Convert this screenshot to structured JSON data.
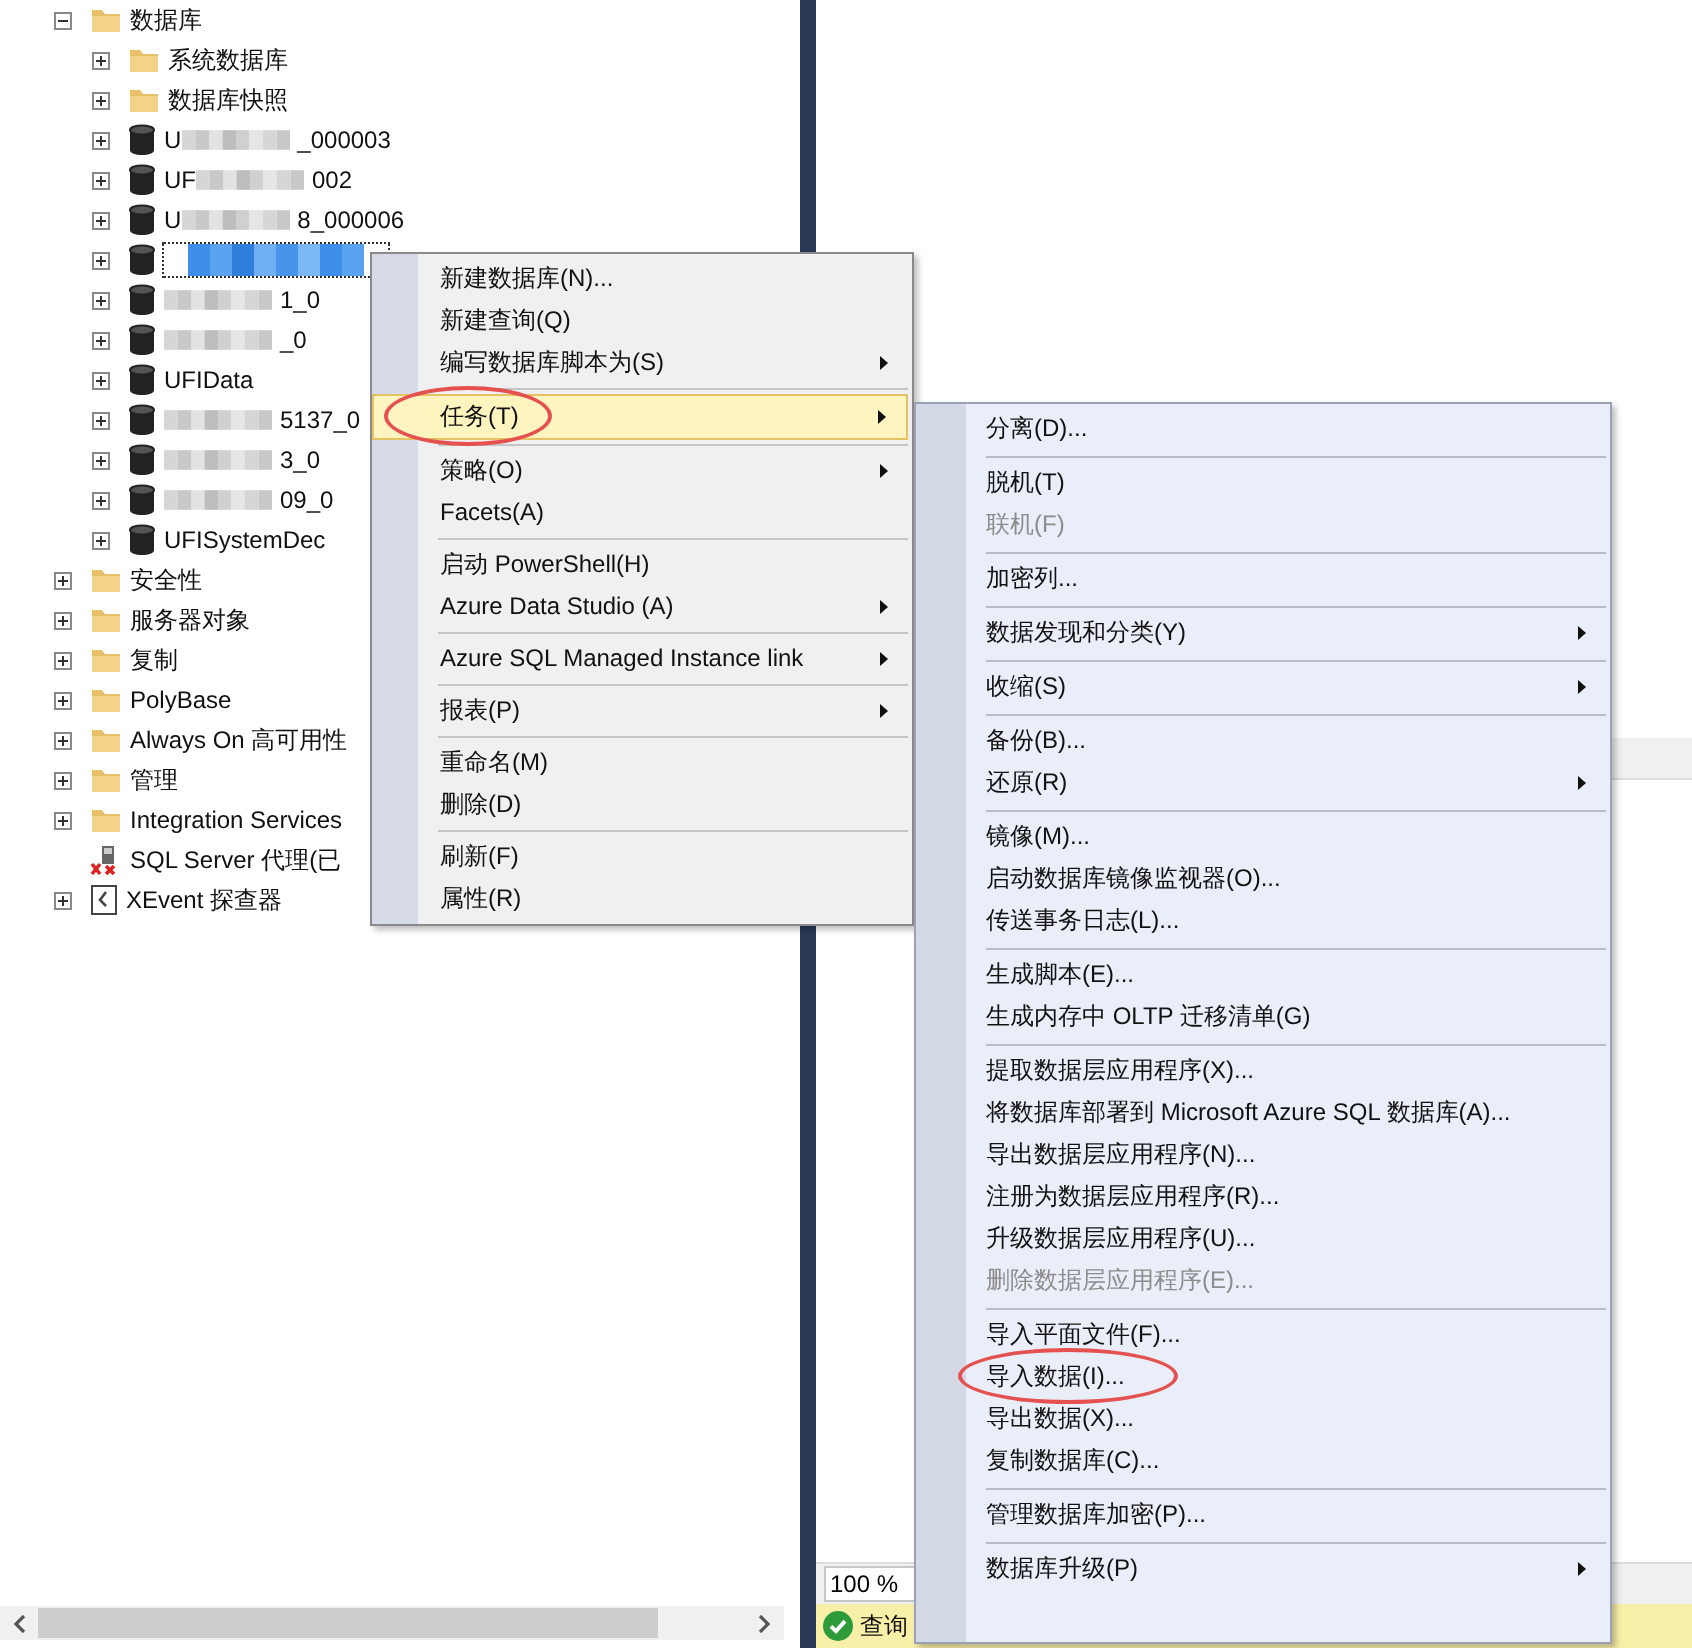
{
  "tree": [
    {
      "label": "数据库",
      "kind": "folder",
      "expanded": true,
      "children": [
        {
          "label": "系统数据库",
          "kind": "folder",
          "expanded": false
        },
        {
          "label": "数据库快照",
          "kind": "folder",
          "expanded": false
        },
        {
          "kind": "database",
          "expanded": false,
          "redacted": true,
          "selected": false,
          "prefix": "U",
          "suffix": "_000003"
        },
        {
          "kind": "database",
          "expanded": false,
          "redacted": true,
          "selected": false,
          "prefix": "UF",
          "suffix": "002"
        },
        {
          "kind": "database",
          "expanded": false,
          "redacted": true,
          "selected": false,
          "prefix": "U",
          "suffix": "8_000006"
        },
        {
          "kind": "database",
          "expanded": false,
          "redacted": true,
          "selected": true
        },
        {
          "kind": "database",
          "expanded": false,
          "redacted": true,
          "selected": false,
          "suffix": "1_0"
        },
        {
          "kind": "database",
          "expanded": false,
          "redacted": true,
          "selected": false,
          "suffix": "_0"
        },
        {
          "kind": "database",
          "expanded": false,
          "redacted": false,
          "selected": false,
          "prefix": "UFIData"
        },
        {
          "kind": "database",
          "expanded": false,
          "redacted": true,
          "selected": false,
          "suffix": "5137_0"
        },
        {
          "kind": "database",
          "expanded": false,
          "redacted": true,
          "selected": false,
          "suffix": "3_0"
        },
        {
          "kind": "database",
          "expanded": false,
          "redacted": true,
          "selected": false,
          "suffix": "09_0"
        },
        {
          "kind": "database",
          "expanded": false,
          "redacted": false,
          "selected": false,
          "prefix": "UFISystemDec"
        }
      ]
    },
    {
      "label": "安全性",
      "kind": "folder",
      "expanded": false
    },
    {
      "label": "服务器对象",
      "kind": "folder",
      "expanded": false
    },
    {
      "label": "复制",
      "kind": "folder",
      "expanded": false
    },
    {
      "label": "PolyBase",
      "kind": "folder",
      "expanded": false
    },
    {
      "label": "Always On 高可用性",
      "kind": "folder",
      "expanded": false
    },
    {
      "label": "管理",
      "kind": "folder",
      "expanded": false
    },
    {
      "label": "Integration Services",
      "kind": "folder",
      "expanded": false
    },
    {
      "label": "SQL Server 代理(已",
      "kind": "agent"
    },
    {
      "label": "XEvent 探查器",
      "kind": "xevent",
      "expanded": false
    }
  ],
  "context_menu": {
    "groups": [
      [
        {
          "label": "新建数据库(N)...",
          "submenu": false,
          "selected": false,
          "circled": false
        },
        {
          "label": "新建查询(Q)",
          "submenu": false,
          "selected": false,
          "circled": false
        },
        {
          "label": "编写数据库脚本为(S)",
          "submenu": true,
          "selected": false,
          "circled": false
        }
      ],
      [
        {
          "label": "任务(T)",
          "submenu": true,
          "selected": true,
          "circled": true
        }
      ],
      [
        {
          "label": "策略(O)",
          "submenu": true,
          "selected": false,
          "circled": false
        },
        {
          "label": "Facets(A)",
          "submenu": false,
          "selected": false,
          "circled": false
        }
      ],
      [
        {
          "label": "启动 PowerShell(H)",
          "submenu": false,
          "selected": false,
          "circled": false
        },
        {
          "label": "Azure Data Studio (A)",
          "submenu": true,
          "selected": false,
          "circled": false
        }
      ],
      [
        {
          "label": "Azure SQL Managed Instance link",
          "submenu": true,
          "selected": false,
          "circled": false
        }
      ],
      [
        {
          "label": "报表(P)",
          "submenu": true,
          "selected": false,
          "circled": false
        }
      ],
      [
        {
          "label": "重命名(M)",
          "submenu": false,
          "selected": false,
          "circled": false
        },
        {
          "label": "删除(D)",
          "submenu": false,
          "selected": false,
          "circled": false
        }
      ],
      [
        {
          "label": "刷新(F)",
          "submenu": false,
          "selected": false,
          "circled": false
        },
        {
          "label": "属性(R)",
          "submenu": false,
          "selected": false,
          "circled": false
        }
      ]
    ]
  },
  "tasks_menu": {
    "groups": [
      [
        {
          "label": "分离(D)...",
          "submenu": false,
          "disabled": false,
          "circled": false
        }
      ],
      [
        {
          "label": "脱机(T)",
          "submenu": false,
          "disabled": false,
          "circled": false
        },
        {
          "label": "联机(F)",
          "submenu": false,
          "disabled": true,
          "circled": false
        }
      ],
      [
        {
          "label": "加密列...",
          "submenu": false,
          "disabled": false,
          "circled": false
        }
      ],
      [
        {
          "label": "数据发现和分类(Y)",
          "submenu": true,
          "disabled": false,
          "circled": false
        }
      ],
      [
        {
          "label": "收缩(S)",
          "submenu": true,
          "disabled": false,
          "circled": false
        }
      ],
      [
        {
          "label": "备份(B)...",
          "submenu": false,
          "disabled": false,
          "circled": false
        },
        {
          "label": "还原(R)",
          "submenu": true,
          "disabled": false,
          "circled": false
        }
      ],
      [
        {
          "label": "镜像(M)...",
          "submenu": false,
          "disabled": false,
          "circled": false
        },
        {
          "label": "启动数据库镜像监视器(O)...",
          "submenu": false,
          "disabled": false,
          "circled": false
        },
        {
          "label": "传送事务日志(L)...",
          "submenu": false,
          "disabled": false,
          "circled": false
        }
      ],
      [
        {
          "label": "生成脚本(E)...",
          "submenu": false,
          "disabled": false,
          "circled": false
        },
        {
          "label": "生成内存中 OLTP 迁移清单(G)",
          "submenu": false,
          "disabled": false,
          "circled": false
        }
      ],
      [
        {
          "label": "提取数据层应用程序(X)...",
          "submenu": false,
          "disabled": false,
          "circled": false
        },
        {
          "label": "将数据库部署到 Microsoft Azure SQL 数据库(A)...",
          "submenu": false,
          "disabled": false,
          "circled": false
        },
        {
          "label": "导出数据层应用程序(N)...",
          "submenu": false,
          "disabled": false,
          "circled": false
        },
        {
          "label": "注册为数据层应用程序(R)...",
          "submenu": false,
          "disabled": false,
          "circled": false
        },
        {
          "label": "升级数据层应用程序(U)...",
          "submenu": false,
          "disabled": false,
          "circled": false
        },
        {
          "label": "删除数据层应用程序(E)...",
          "submenu": false,
          "disabled": true,
          "circled": false
        }
      ],
      [
        {
          "label": "导入平面文件(F)...",
          "submenu": false,
          "disabled": false,
          "circled": false
        },
        {
          "label": "导入数据(I)...",
          "submenu": false,
          "disabled": false,
          "circled": true
        },
        {
          "label": "导出数据(X)...",
          "submenu": false,
          "disabled": false,
          "circled": false
        },
        {
          "label": "复制数据库(C)...",
          "submenu": false,
          "disabled": false,
          "circled": false
        }
      ],
      [
        {
          "label": "管理数据库加密(P)...",
          "submenu": false,
          "disabled": false,
          "circled": false
        }
      ],
      [
        {
          "label": "数据库升级(P)",
          "submenu": true,
          "disabled": false,
          "circled": false
        }
      ]
    ]
  },
  "zoom_field": {
    "value": "100 %"
  },
  "status_bar": {
    "text": "查询"
  }
}
